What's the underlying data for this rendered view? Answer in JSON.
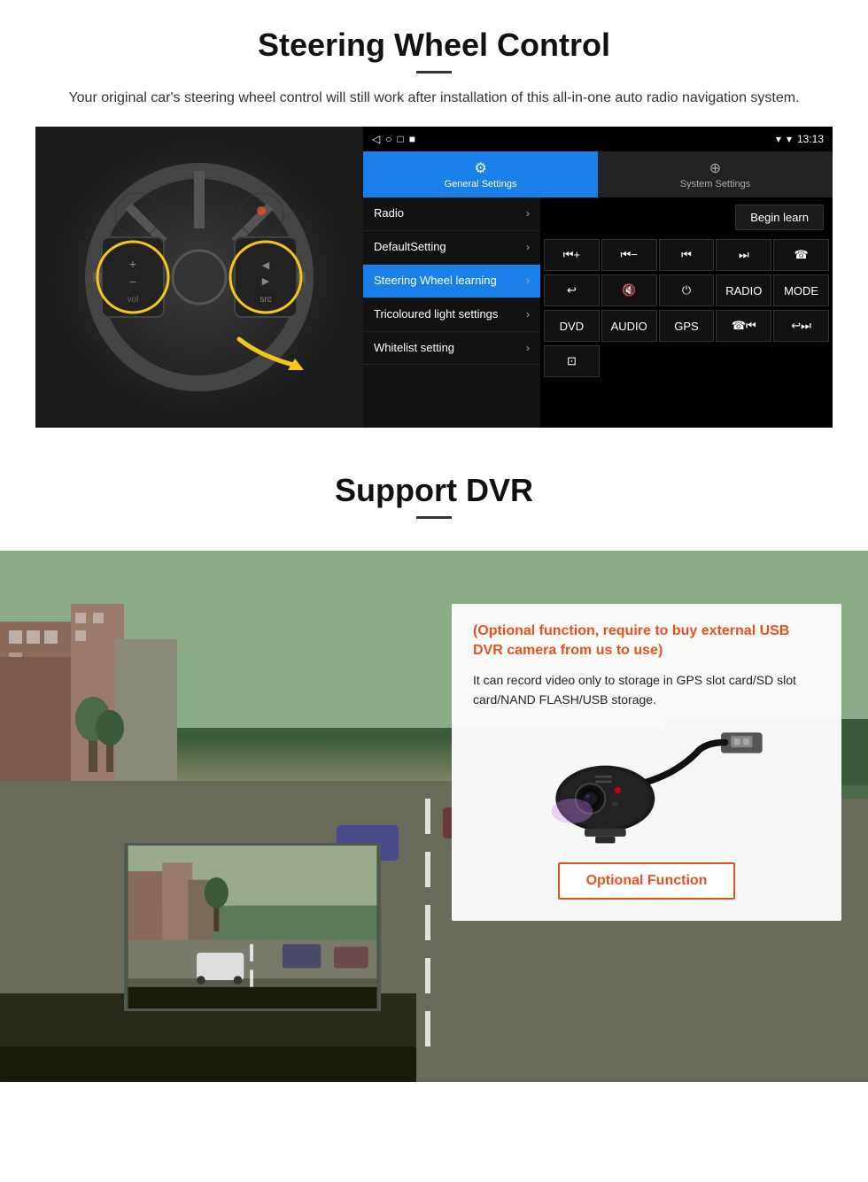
{
  "steering": {
    "title": "Steering Wheel Control",
    "description": "Your original car's steering wheel control will still work after installation of this all-in-one auto radio navigation system.",
    "statusbar": {
      "signal": "▼",
      "wifi": "▾",
      "time": "13:13"
    },
    "nav_icons": [
      "◁",
      "○",
      "□",
      "■"
    ],
    "tabs": [
      {
        "icon": "⚙",
        "label": "General Settings",
        "active": true
      },
      {
        "icon": "⚙",
        "label": "System Settings",
        "active": false
      }
    ],
    "menu_items": [
      {
        "label": "Radio",
        "active": false
      },
      {
        "label": "DefaultSetting",
        "active": false
      },
      {
        "label": "Steering Wheel learning",
        "active": true
      },
      {
        "label": "Tricoloured light settings",
        "active": false
      },
      {
        "label": "Whitelist setting",
        "active": false
      }
    ],
    "begin_learn_label": "Begin learn",
    "control_buttons_row1": [
      "⏮+",
      "⏮-",
      "⏮",
      "⏭",
      "📞"
    ],
    "control_buttons_row2": [
      "↩",
      "🔇",
      "⏻",
      "RADIO",
      "MODE"
    ],
    "control_buttons_row3": [
      "DVD",
      "AUDIO",
      "GPS",
      "📞⏮",
      "↩⏭"
    ],
    "control_buttons_row4": [
      "⊡"
    ]
  },
  "dvr": {
    "title": "Support DVR",
    "optional_text": "(Optional function, require to buy external USB DVR camera from us to use)",
    "description": "It can record video only to storage in GPS slot card/SD slot card/NAND FLASH/USB storage.",
    "optional_fn_label": "Optional Function"
  }
}
